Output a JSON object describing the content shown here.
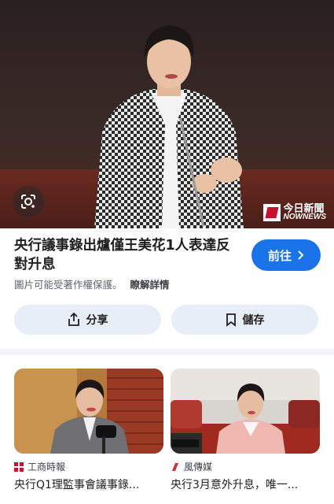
{
  "hero": {
    "lens_icon": "google-lens-icon",
    "watermark_zh": "今日新聞",
    "watermark_en": "NOWNEWS"
  },
  "result": {
    "title": "央行議事錄出爐僅王美花1人表達反對升息",
    "visit_label": "前往",
    "copyright_notice": "圖片可能受著作權保護。",
    "learn_more": "瞭解詳情"
  },
  "actions": {
    "share_label": "分享",
    "save_label": "儲存"
  },
  "related": [
    {
      "source": "工商時報",
      "title": "央行Q1理監事會議事錄...",
      "source_icon": "ctee-logo-icon"
    },
    {
      "source": "風傳媒",
      "title": "央行3月意外升息，唯一...",
      "source_icon": "storm-media-logo-icon"
    }
  ],
  "colors": {
    "accent": "#1a73e8",
    "chip_bg": "#e8eef7",
    "muted_text": "#5f6368"
  }
}
